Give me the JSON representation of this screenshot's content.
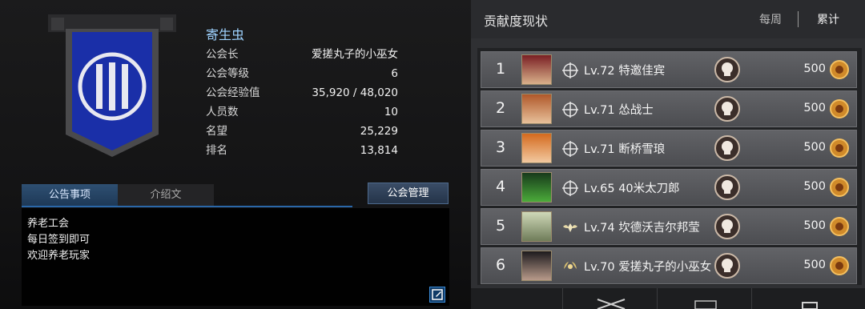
{
  "guild": {
    "name": "寄生虫",
    "info": [
      {
        "label": "公会长",
        "value": "爱搓丸子的小巫女"
      },
      {
        "label": "公会等级",
        "value": "6"
      },
      {
        "label": "公会经验值",
        "value": "35,920 / 48,020"
      },
      {
        "label": "人员数",
        "value": "10"
      },
      {
        "label": "名望",
        "value": "25,229"
      },
      {
        "label": "排名",
        "value": "13,814"
      }
    ]
  },
  "tabs": {
    "notice": "公告事项",
    "intro": "介绍文"
  },
  "manage_label": "公会管理",
  "notice_lines": [
    "养老工会",
    "每日签到即可",
    "欢迎养老玩家"
  ],
  "contribution": {
    "title": "贡献度现状",
    "period_week": "每周",
    "period_total": "累计",
    "rows": [
      {
        "rank": "1",
        "name": "Lv.72 特邀佳宾",
        "points": "500"
      },
      {
        "rank": "2",
        "name": "Lv.71 怂战士",
        "points": "500"
      },
      {
        "rank": "3",
        "name": "Lv.71 断桥雪琅",
        "points": "500"
      },
      {
        "rank": "4",
        "name": "Lv.65 40米太刀郎",
        "points": "500"
      },
      {
        "rank": "5",
        "name": "Lv.74 坎德沃吉尔邦莹",
        "points": "500"
      },
      {
        "rank": "6",
        "name": "Lv.70 爱搓丸子的小巫女",
        "points": "500"
      }
    ]
  },
  "colors": {
    "accent": "#2a67a8",
    "banner": "#1a2fa8",
    "name_blue": "#9fd3ff"
  }
}
